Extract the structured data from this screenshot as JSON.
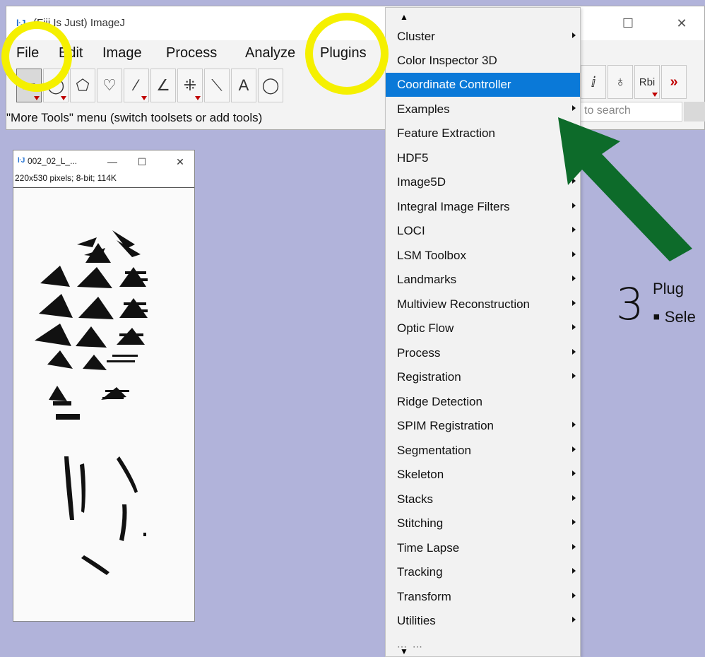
{
  "main_window": {
    "title": "(Fiji Is Just) ImageJ",
    "icon": "imagej-icon",
    "menus": [
      "File",
      "Edit",
      "Image",
      "Process",
      "Analyze",
      "Plugins"
    ],
    "status": "\"More Tools\" menu (switch toolsets or add tools)",
    "search_placeholder": "to search",
    "right_tools": [
      "brush-icon",
      "dropper-icon",
      "Rbi",
      "»"
    ]
  },
  "image_window": {
    "title": "002_02_L_...",
    "info": "220x530 pixels; 8-bit; 114K"
  },
  "plugins_menu": {
    "items": [
      {
        "label": "Cluster",
        "submenu": true
      },
      {
        "label": "Color Inspector 3D",
        "submenu": false
      },
      {
        "label": "Coordinate Controller",
        "submenu": false,
        "highlighted": true
      },
      {
        "label": "Examples",
        "submenu": true
      },
      {
        "label": "Feature Extraction",
        "submenu": false
      },
      {
        "label": "HDF5",
        "submenu": true
      },
      {
        "label": "Image5D",
        "submenu": true
      },
      {
        "label": "Integral Image Filters",
        "submenu": true
      },
      {
        "label": "LOCI",
        "submenu": true
      },
      {
        "label": "LSM Toolbox",
        "submenu": true
      },
      {
        "label": "Landmarks",
        "submenu": true
      },
      {
        "label": "Multiview Reconstruction",
        "submenu": true
      },
      {
        "label": "Optic Flow",
        "submenu": true
      },
      {
        "label": "Process",
        "submenu": true
      },
      {
        "label": "Registration",
        "submenu": true
      },
      {
        "label": "Ridge Detection",
        "submenu": false
      },
      {
        "label": "SPIM Registration",
        "submenu": true
      },
      {
        "label": "Segmentation",
        "submenu": true
      },
      {
        "label": "Skeleton",
        "submenu": true
      },
      {
        "label": "Stacks",
        "submenu": true
      },
      {
        "label": "Stitching",
        "submenu": true
      },
      {
        "label": "Time Lapse",
        "submenu": true
      },
      {
        "label": "Tracking",
        "submenu": true
      },
      {
        "label": "Transform",
        "submenu": true
      },
      {
        "label": "Utilities",
        "submenu": true
      }
    ],
    "highlight_color": "#0a79d8"
  },
  "annotation": {
    "step_number": "3",
    "line1": "Plug",
    "line2": "Sele",
    "circle_color": "#f5f000",
    "arrow_color": "#0d6b2a"
  }
}
